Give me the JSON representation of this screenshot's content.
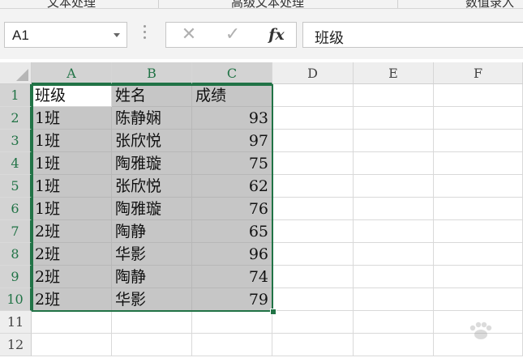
{
  "ribbon": {
    "tabs": [
      "文本处理",
      "高级文本处理",
      "数值录入"
    ]
  },
  "formula_bar": {
    "name_box": "A1",
    "cancel_icon": "close-icon",
    "enter_icon": "check-icon",
    "fx_label": "fx",
    "formula_value": "班级"
  },
  "columns": [
    "A",
    "B",
    "C",
    "D",
    "E",
    "F"
  ],
  "rows": [
    "1",
    "2",
    "3",
    "4",
    "5",
    "6",
    "7",
    "8",
    "9",
    "10",
    "11",
    "12"
  ],
  "table": {
    "headers": [
      "班级",
      "姓名",
      "成绩"
    ],
    "records": [
      [
        "1班",
        "陈静娴",
        "93"
      ],
      [
        "1班",
        "张欣悦",
        "97"
      ],
      [
        "1班",
        "陶雅璇",
        "75"
      ],
      [
        "1班",
        "张欣悦",
        "62"
      ],
      [
        "1班",
        "陶雅璇",
        "76"
      ],
      [
        "2班",
        "陶静",
        "65"
      ],
      [
        "2班",
        "华影",
        "96"
      ],
      [
        "2班",
        "陶静",
        "74"
      ],
      [
        "2班",
        "华影",
        "79"
      ]
    ]
  },
  "colors": {
    "selection": "#217346",
    "selected_fill": "#c6c6c6"
  }
}
